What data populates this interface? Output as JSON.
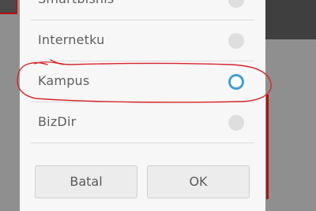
{
  "dialog": {
    "options": [
      {
        "label": "Smartbisnis",
        "selected": false
      },
      {
        "label": "Internetku",
        "selected": false
      },
      {
        "label": "Kampus",
        "selected": true
      },
      {
        "label": "BizDir",
        "selected": false
      }
    ],
    "buttons": {
      "cancel_label": "Batal",
      "ok_label": "OK"
    }
  },
  "colors": {
    "selected_radio": "#3f9edb",
    "annotation_stroke": "#d6262a"
  }
}
